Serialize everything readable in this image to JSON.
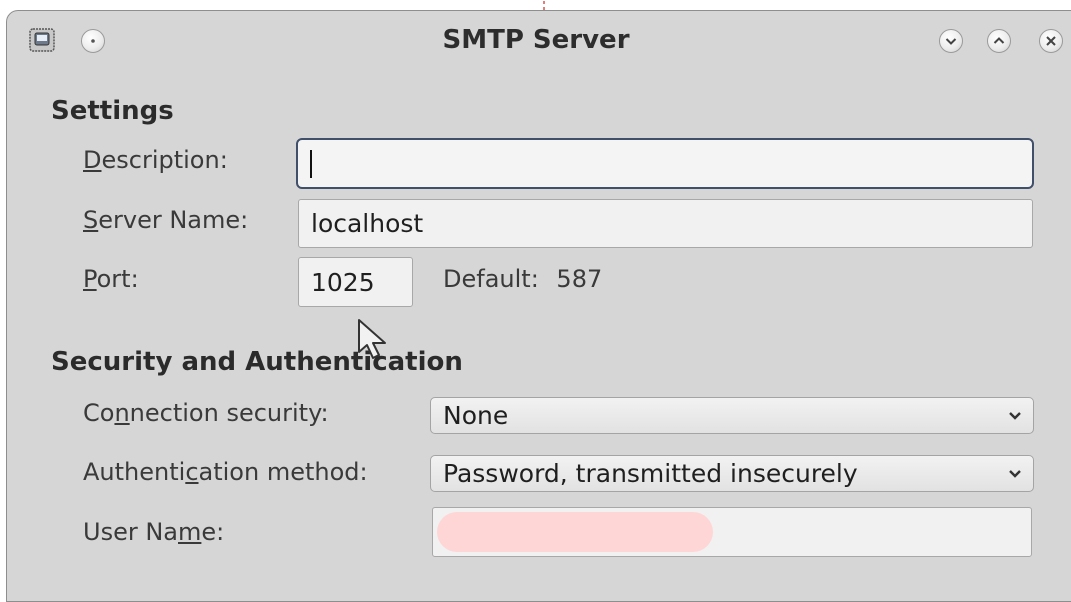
{
  "window": {
    "title": "SMTP Server"
  },
  "settings": {
    "heading": "Settings",
    "description_label_mnemonic": "D",
    "description_label_rest": "escription:",
    "description_value": "",
    "server_name_label_mnemonic": "S",
    "server_name_label_rest": "erver Name:",
    "server_name_value": "localhost",
    "port_label_mnemonic": "P",
    "port_label_rest": "ort:",
    "port_value": "1025",
    "default_label": "Default:",
    "default_value": "587"
  },
  "security": {
    "heading": "Security and Authentication",
    "connection_label_pre": "Co",
    "connection_label_mnemonic": "n",
    "connection_label_post": "nection security:",
    "connection_value": "None",
    "auth_label_pre": "Authenti",
    "auth_label_mnemonic": "c",
    "auth_label_post": "ation method:",
    "auth_value": "Password, transmitted insecurely",
    "username_label_pre": "User Na",
    "username_label_mnemonic": "m",
    "username_label_post": "e:",
    "username_value": ""
  },
  "icons": {
    "app": "mail-server-icon",
    "menu": "window-menu-icon",
    "minimize": "minimize-icon",
    "maximize": "maximize-icon",
    "close": "close-icon",
    "dropdown": "chevron-down-icon",
    "cursor": "mouse-pointer-icon"
  },
  "colors": {
    "window_bg": "#d6d6d6",
    "focus_border": "#40506a",
    "redaction": "#ffd6d6"
  }
}
